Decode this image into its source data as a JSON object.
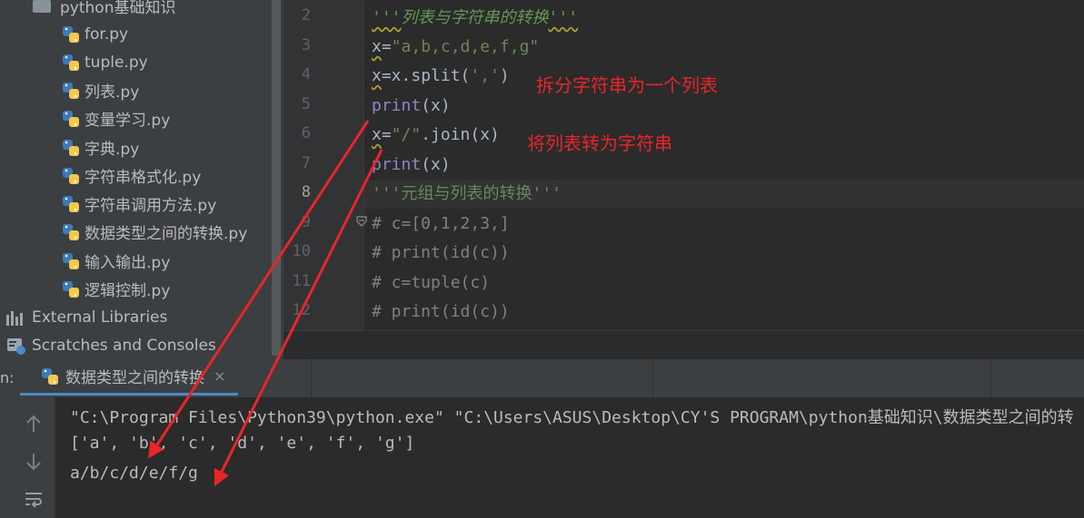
{
  "project": {
    "folder": "python基础知识",
    "files": [
      "for.py",
      "tuple.py",
      "列表.py",
      "变量学习.py",
      "字典.py",
      "字符串格式化.py",
      "字符串调用方法.py",
      "数据类型之间的转换.py",
      "输入输出.py",
      "逻辑控制.py"
    ],
    "external_libraries": "External Libraries",
    "scratches": "Scratches and Consoles"
  },
  "editor": {
    "line_numbers": [
      "2",
      "3",
      "4",
      "5",
      "6",
      "7",
      "8",
      "9",
      "10",
      "11",
      "12"
    ],
    "current_line": "8",
    "lines": {
      "l2_quote_open": "'''",
      "l2_text": "列表与字符串的转换",
      "l2_quote_close": "'''",
      "l3_var": "x",
      "l3_rest": "=",
      "l3_str": "\"a,b,c,d,e,f,g\"",
      "l4_var": "x",
      "l4_pre": "=x.split(",
      "l4_str": "','",
      "l4_post": ")",
      "l5_builtin": "print",
      "l5_rest": "(x)",
      "l6_var": "x",
      "l6_eq": "=",
      "l6_str": "\"/\"",
      "l6_rest": ".join(x)",
      "l7_builtin": "print",
      "l7_rest": "(x)",
      "l8": "'''元组与列表的转换'''",
      "l9": "# c=[0,1,2,3,]",
      "l10": "# print(id(c))",
      "l11": "# c=tuple(c)",
      "l12": "# print(id(c))"
    },
    "annotations": {
      "split_note": "拆分字符串为一个列表",
      "join_note": "将列表转为字符串"
    }
  },
  "run": {
    "label": "n:",
    "tab_title": "数据类型之间的转换",
    "close_glyph": "×",
    "console": [
      "\"C:\\Program Files\\Python39\\python.exe\" \"C:\\Users\\ASUS\\Desktop\\CY'S PROGRAM\\python基础知识\\数据类型之间的转",
      "['a', 'b', 'c', 'd', 'e', 'f', 'g']",
      "a/b/c/d/e/f/g"
    ]
  },
  "colors": {
    "annotation": "#e8262a",
    "python_icon_blue": "#3d7ab8",
    "python_icon_yellow": "#f2c94c"
  }
}
